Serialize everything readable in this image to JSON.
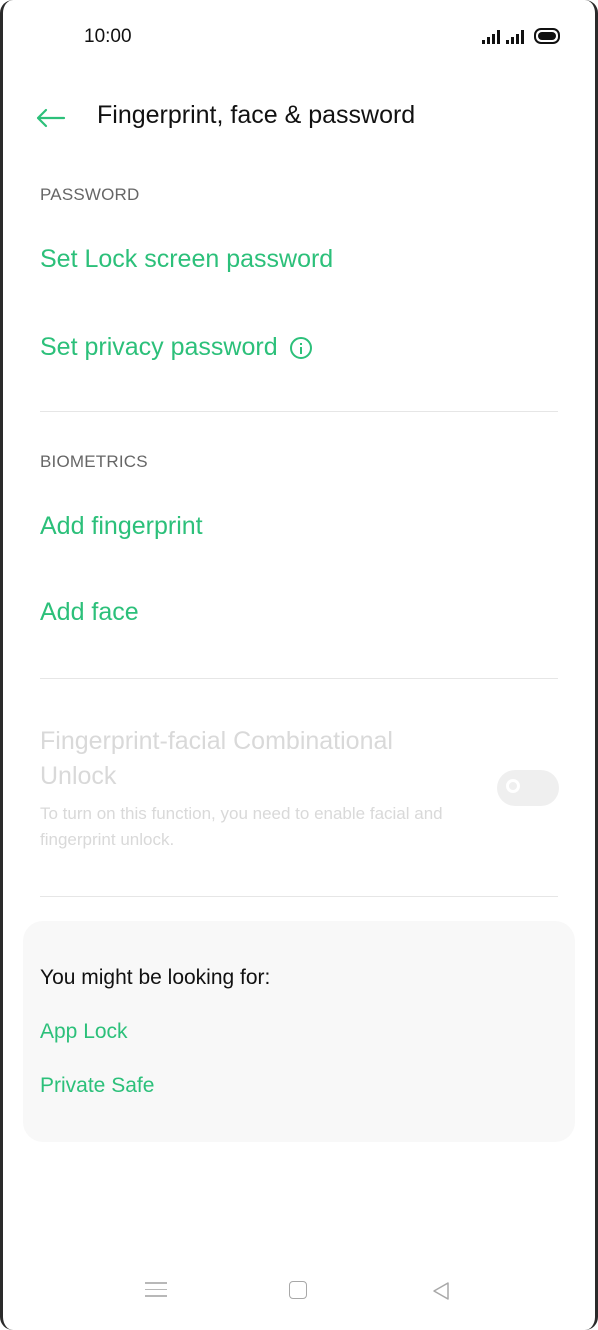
{
  "status_bar": {
    "time": "10:00",
    "icons": [
      "signal-icon",
      "signal-icon",
      "battery-icon"
    ]
  },
  "header": {
    "back_icon": "arrow-left-icon",
    "title": "Fingerprint, face & password"
  },
  "password_section": {
    "label": "PASSWORD",
    "items": [
      {
        "label": "Set Lock screen password"
      },
      {
        "label": "Set privacy password",
        "icon": "info-icon"
      }
    ]
  },
  "biometrics_section": {
    "label": "BIOMETRICS",
    "items": [
      {
        "label": "Add fingerprint"
      },
      {
        "label": "Add face"
      }
    ]
  },
  "combination_unlock": {
    "title": "Fingerprint-facial Combinational Unlock",
    "description": "To turn on this function, you need to enable facial and fingerprint unlock.",
    "toggle_state": "off",
    "enabled": false
  },
  "suggestions": {
    "title": "You might be looking for:",
    "links": [
      {
        "label": "App Lock"
      },
      {
        "label": "Private Safe"
      }
    ]
  },
  "nav_bar": {
    "icons": [
      "menu-icon",
      "home-icon",
      "back-triangle-icon"
    ]
  },
  "colors": {
    "accent": "#2cc07a",
    "disabled_text": "#d9d9d9",
    "card_bg": "#f8f8f8"
  }
}
